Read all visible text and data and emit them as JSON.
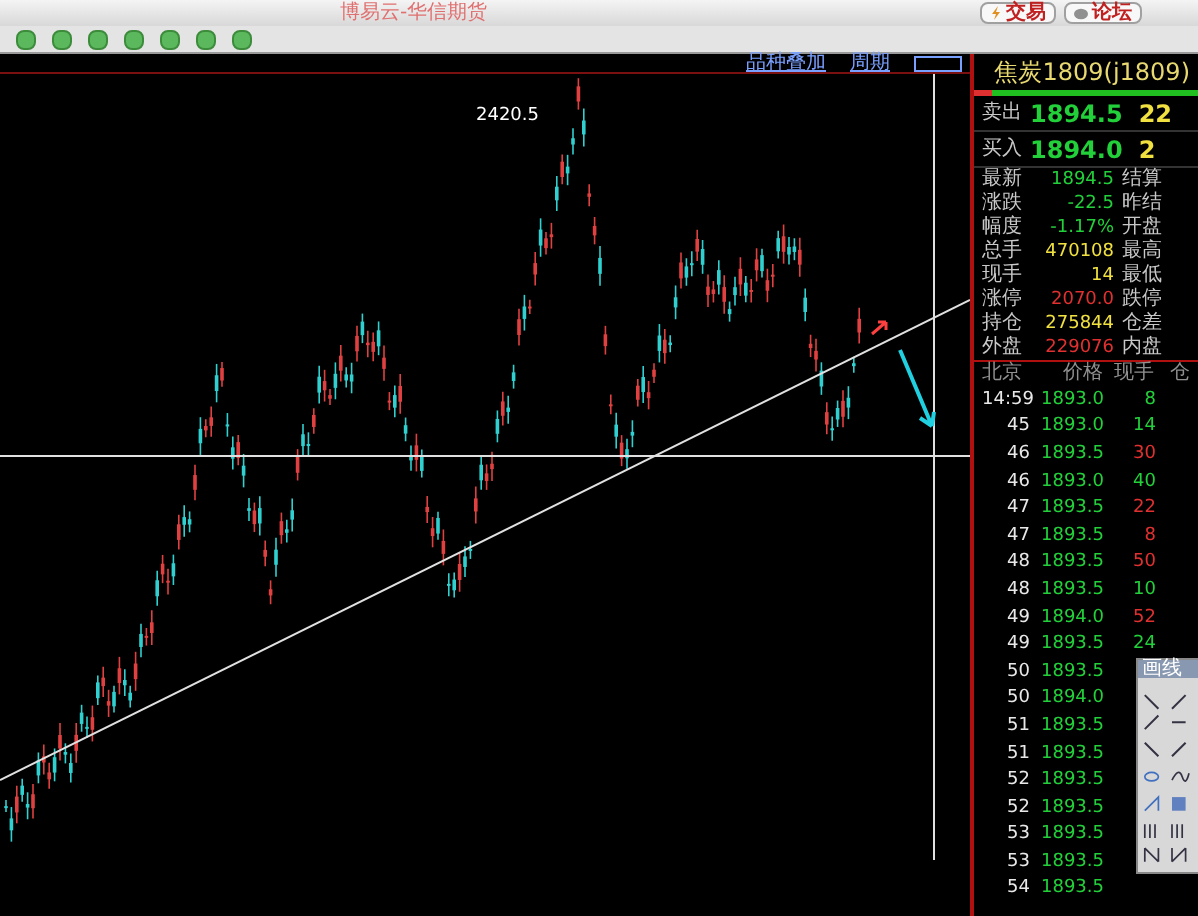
{
  "window": {
    "title": "博易云-华信期货",
    "buttons": [
      {
        "label": "交易",
        "kind": "trade"
      },
      {
        "label": "论坛",
        "kind": "forum"
      }
    ]
  },
  "chart": {
    "links": [
      "品种叠加",
      "周期"
    ],
    "peak_label": "2420.5"
  },
  "quote": {
    "title": "焦炭1809(j1809)",
    "ratio_bar": {
      "level": 0.08
    },
    "sell": {
      "label": "卖出",
      "price": "1894.5",
      "volume": "22"
    },
    "buy": {
      "label": "买入",
      "price": "1894.0",
      "volume": "2"
    },
    "stats": [
      {
        "label": "最新",
        "value": "1894.5",
        "color": "#22d03a",
        "label2": "结算"
      },
      {
        "label": "涨跌",
        "value": "-22.5",
        "color": "#22d03a",
        "label2": "昨结"
      },
      {
        "label": "幅度",
        "value": "-1.17%",
        "color": "#22d03a",
        "label2": "开盘"
      },
      {
        "label": "总手",
        "value": "470108",
        "color": "#f0e040",
        "label2": "最高"
      },
      {
        "label": "现手",
        "value": "14",
        "color": "#f0e040",
        "label2": "最低"
      },
      {
        "label": "涨停",
        "value": "2070.0",
        "color": "#e03030",
        "label2": "跌停"
      },
      {
        "label": "持仓",
        "value": "275844",
        "color": "#f0e040",
        "label2": "仓差"
      },
      {
        "label": "外盘",
        "value": "229076",
        "color": "#e03030",
        "label2": "内盘"
      }
    ],
    "ticks_header": [
      "北京",
      "价格",
      "现手",
      "仓"
    ],
    "ticks": [
      {
        "time": "14:59",
        "price": "1893.0",
        "volume": "8",
        "color": "#22d03a"
      },
      {
        "time": "45",
        "price": "1893.0",
        "volume": "14",
        "color": "#22d03a"
      },
      {
        "time": "46",
        "price": "1893.5",
        "volume": "30",
        "color": "#e03030"
      },
      {
        "time": "46",
        "price": "1893.0",
        "volume": "40",
        "color": "#22d03a"
      },
      {
        "time": "47",
        "price": "1893.5",
        "volume": "22",
        "color": "#e03030"
      },
      {
        "time": "47",
        "price": "1893.5",
        "volume": "8",
        "color": "#e03030"
      },
      {
        "time": "48",
        "price": "1893.5",
        "volume": "50",
        "color": "#e03030"
      },
      {
        "time": "48",
        "price": "1893.5",
        "volume": "10",
        "color": "#22d03a"
      },
      {
        "time": "49",
        "price": "1894.0",
        "volume": "52",
        "color": "#e03030"
      },
      {
        "time": "49",
        "price": "1893.5",
        "volume": "24",
        "color": "#22d03a"
      },
      {
        "time": "50",
        "price": "1893.5"
      },
      {
        "time": "50",
        "price": "1894.0"
      },
      {
        "time": "51",
        "price": "1893.5"
      },
      {
        "time": "51",
        "price": "1893.5"
      },
      {
        "time": "52",
        "price": "1893.5"
      },
      {
        "time": "52",
        "price": "1893.5"
      },
      {
        "time": "53",
        "price": "1893.5"
      },
      {
        "time": "53",
        "price": "1893.5"
      },
      {
        "time": "54",
        "price": "1893.5"
      }
    ]
  },
  "palette": {
    "title": "画线"
  }
}
